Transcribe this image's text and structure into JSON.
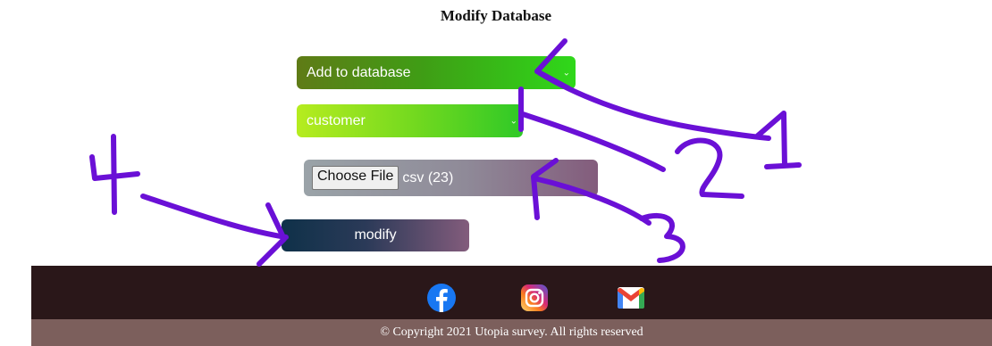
{
  "page": {
    "title": "Modify Database"
  },
  "form": {
    "operation_select": {
      "selected": "Add to database"
    },
    "table_select": {
      "selected": "customer"
    },
    "file_input": {
      "button_label": "Choose File",
      "file_name": "csv (23)"
    },
    "submit_label": "modify"
  },
  "footer": {
    "social_icons": [
      "facebook-icon",
      "instagram-icon",
      "gmail-icon"
    ],
    "copyright": "© Copyright 2021 Utopia survey. All rights reserved"
  },
  "annotations": [
    "1",
    "2",
    "3",
    "4"
  ],
  "colors": {
    "annotation_ink": "#6a10d6",
    "footer_dark": "#2a1719",
    "footer_light": "#7c5f5c"
  }
}
